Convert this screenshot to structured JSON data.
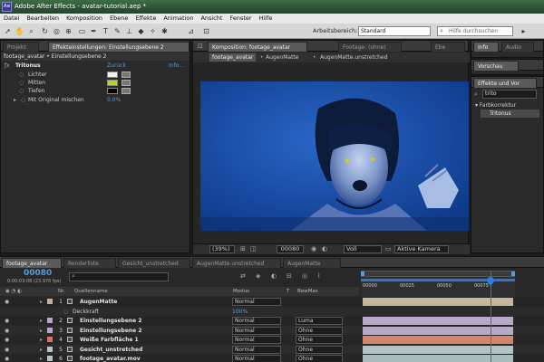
{
  "app": {
    "title": "Adobe After Effects - avatar-tutorial.aep *",
    "logo": "Ae"
  },
  "menu": [
    "Datei",
    "Bearbeiten",
    "Komposition",
    "Ebene",
    "Effekte",
    "Animation",
    "Ansicht",
    "Fenster",
    "Hilfe"
  ],
  "toolbar": {
    "workspace_label": "Arbeitsbereich:",
    "workspace_value": "Standard",
    "search_placeholder": "Hilfe durchsuchen"
  },
  "effect_panel": {
    "tabs": [
      "Projekt",
      "Effekteinstellungen: Einstellungsebene 2"
    ],
    "breadcrumb": "footage_avatar • Einstellungsebene 2",
    "effect_name": "Tritonus",
    "reset": "Zurück",
    "info": "Info...",
    "params": [
      {
        "name": "Lichter",
        "color": "#f0f0f0"
      },
      {
        "name": "Mitten",
        "color": "#b6d80f"
      },
      {
        "name": "Tiefen",
        "color": "#050505"
      }
    ],
    "blend": {
      "name": "Mit Original mischen",
      "value": "0,0%"
    }
  },
  "comp_panel": {
    "tabs": [
      "Komposition: footage_avatar",
      "Footage: (ohne)",
      "Ebe"
    ],
    "subtabs": [
      "footage_avatar",
      "AugenMatte",
      "AugenMatte.unstretched"
    ],
    "zoom": "(39%)",
    "timecode": "00080",
    "resolution": "Voll",
    "camera": "Aktive Kamera"
  },
  "right_panel": {
    "tabs": [
      "Info",
      "Audio"
    ],
    "preview_tab": "Vorschau",
    "effects_tab": "Effekte und Vor",
    "search_value": "trito",
    "category": "Farbkorrektur",
    "result": "Tritonus"
  },
  "timeline": {
    "tabs": [
      "footage_avatar",
      "Renderliste",
      "Gesicht_unstretched",
      "AugenMatte.unstretched",
      "AugenMatte"
    ],
    "timecode": "00080",
    "timecode_sub": "0:00:03:08 (23.976 fps)",
    "columns": {
      "nr": "Nr.",
      "source": "Quellenname",
      "mode": "Modus",
      "t": "T",
      "trkmat": "BewMas"
    },
    "ruler_labels": [
      "00000",
      "00025",
      "00050",
      "00075"
    ],
    "playhead_fraction": 0.84,
    "layers": [
      {
        "nr": "1",
        "name": "AugenMatte",
        "mode": "Normal",
        "trkmat": "",
        "label_color": "#c4b090",
        "bar_color": "#c7b79a",
        "bold": true
      },
      {
        "nr": "",
        "name": "Deckkraft",
        "mode": "100%",
        "trkmat": "",
        "label_color": "",
        "bar_color": "",
        "bold": false
      },
      {
        "nr": "2",
        "name": "Einstellungsebene 2",
        "mode": "Normal",
        "trkmat": "Luma",
        "label_color": "#b9a7c9",
        "bar_color": "#b8aac7",
        "bold": true
      },
      {
        "nr": "3",
        "name": "Einstellungsebene 2",
        "mode": "Normal",
        "trkmat": "Ohne",
        "label_color": "#b9a7c9",
        "bar_color": "#b8aac7",
        "bold": true
      },
      {
        "nr": "4",
        "name": "Weiße Farbfläche 1",
        "mode": "Normal",
        "trkmat": "Ohne",
        "label_color": "#d8745f",
        "bar_color": "#d7846f",
        "bold": true
      },
      {
        "nr": "5",
        "name": "Gesicht_unstretched",
        "mode": "Normal",
        "trkmat": "Ohne",
        "label_color": "#b3c5c7",
        "bar_color": "#b3c2c4",
        "bold": true
      },
      {
        "nr": "6",
        "name": "footage_avatar.mov",
        "mode": "Normal",
        "trkmat": "Ohne",
        "label_color": "#b3c5c7",
        "bar_color": "#a9bcc0",
        "bold": true
      }
    ]
  }
}
